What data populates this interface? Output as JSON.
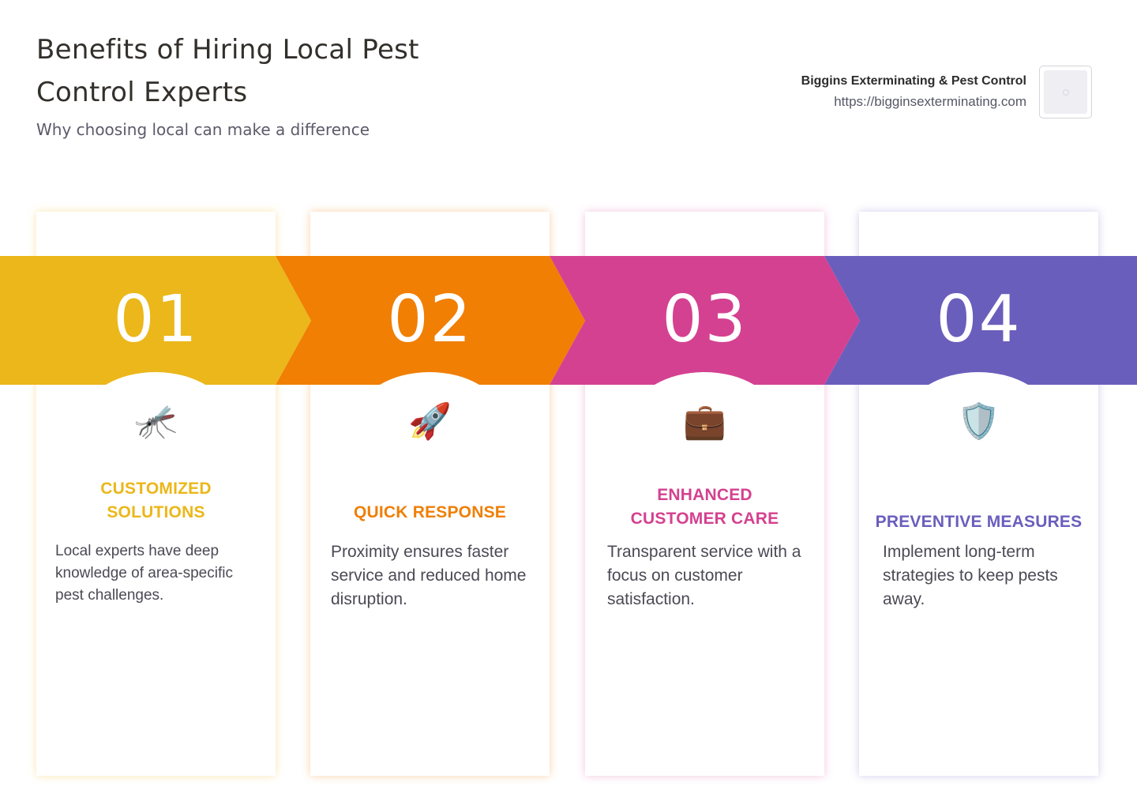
{
  "header": {
    "title": "Benefits of Hiring Local Pest Control Experts",
    "subtitle": "Why choosing local can make a difference"
  },
  "brand": {
    "name": "Biggins Exterminating & Pest Control",
    "url": "https://bigginsexterminating.com"
  },
  "colors": {
    "yellow": "#ebb71a",
    "orange": "#f07f04",
    "pink": "#d44191",
    "purple": "#6a5ebc"
  },
  "steps": [
    {
      "number": "01",
      "icon": "mosquito-icon",
      "icon_glyph": "🦟",
      "title": "CUSTOMIZED SOLUTIONS",
      "text": "Local experts have deep knowledge of area-specific pest challenges."
    },
    {
      "number": "02",
      "icon": "rocket-icon",
      "icon_glyph": "🚀",
      "title": "QUICK RESPONSE",
      "text": "Proximity ensures faster service and reduced home disruption."
    },
    {
      "number": "03",
      "icon": "briefcase-icon",
      "icon_glyph": "💼",
      "title": "ENHANCED CUSTOMER CARE",
      "text": "Transparent service with a focus on customer satisfaction."
    },
    {
      "number": "04",
      "icon": "shield-icon",
      "icon_glyph": "🛡️",
      "title": "PREVENTIVE MEASURES",
      "text": "Implement long-term strategies to keep pests away."
    }
  ]
}
